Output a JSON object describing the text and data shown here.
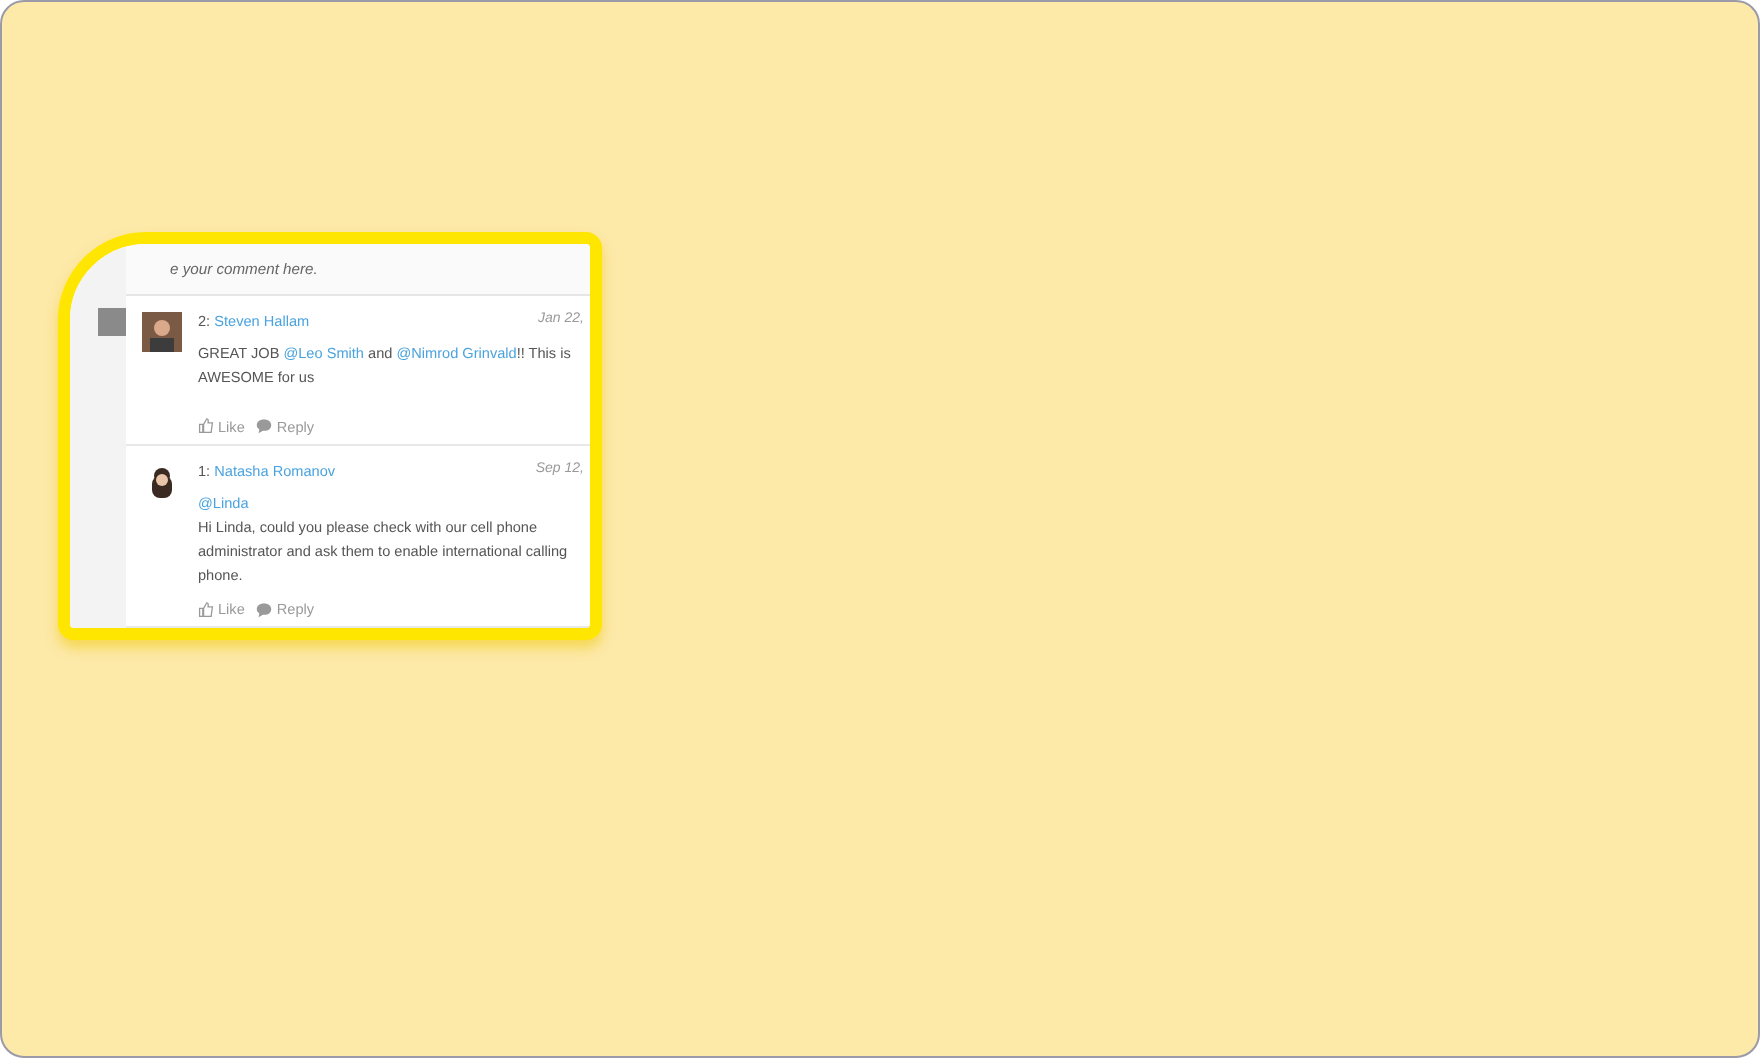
{
  "comment_box": {
    "placeholder": "e your comment here."
  },
  "comments": [
    {
      "number": "2:",
      "author": "Steven Hallam",
      "date": "Jan 22,",
      "lines": [
        [
          {
            "kind": "text",
            "text": "GREAT JOB "
          },
          {
            "kind": "mention",
            "text": "@Leo Smith"
          },
          {
            "kind": "text",
            "text": " and "
          },
          {
            "kind": "mention",
            "text": "@Nimrod Grinvald"
          },
          {
            "kind": "text",
            "text": "!!  This is"
          }
        ],
        [
          {
            "kind": "text",
            "text": "AWESOME for us"
          }
        ]
      ],
      "like": "Like",
      "reply": "Reply",
      "kind": "man"
    },
    {
      "number": "1:",
      "author": "Natasha Romanov",
      "date": "Sep 12,",
      "lines": [
        [
          {
            "kind": "mention",
            "text": "@Linda"
          }
        ],
        [
          {
            "kind": "text",
            "text": " Hi  Linda, could you please check with our cell phone"
          }
        ],
        [
          {
            "kind": "text",
            "text": "administrator and ask them to enable international calling"
          }
        ],
        [
          {
            "kind": "text",
            "text": "phone."
          }
        ]
      ],
      "like": "Like",
      "reply": "Reply",
      "kind": "woman"
    }
  ]
}
